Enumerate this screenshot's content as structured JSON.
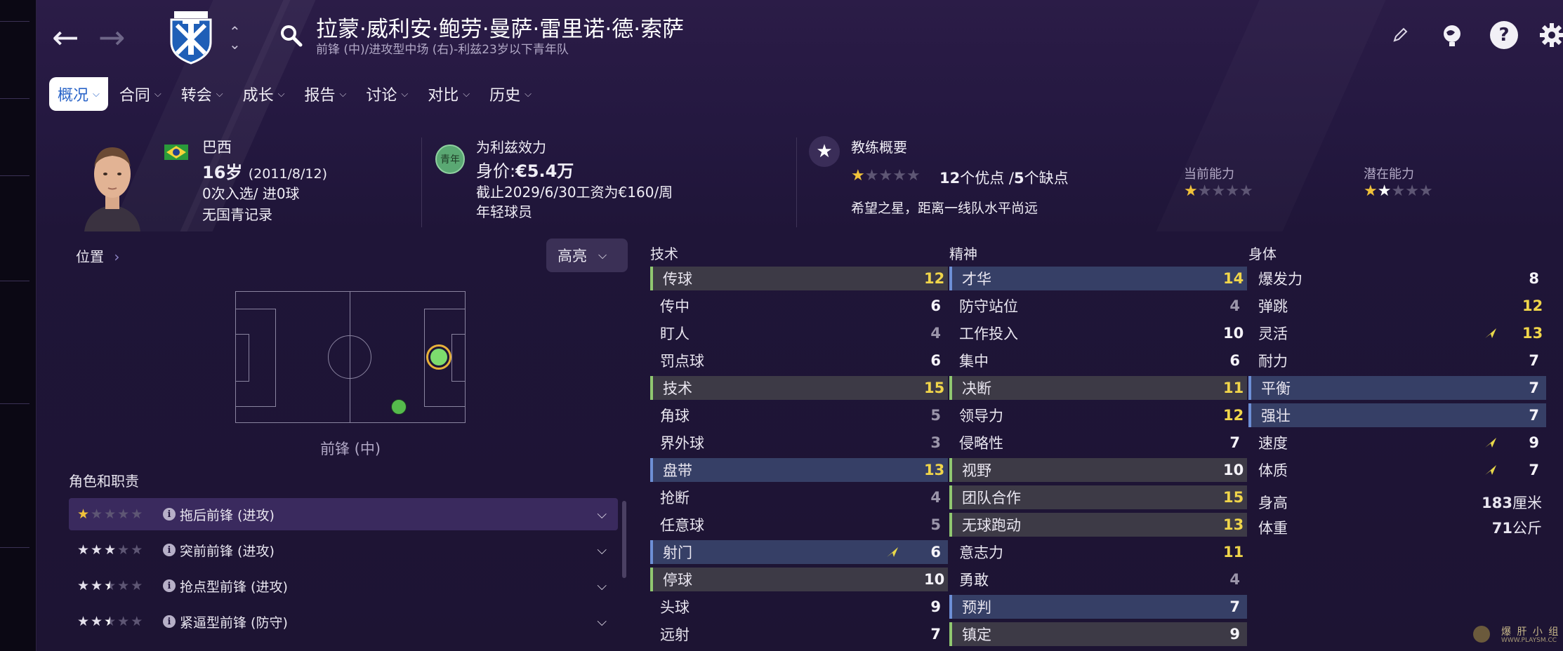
{
  "header": {
    "player_name": "拉蒙·威利安·鲍劳·曼萨·雷里诺·德·索萨",
    "subtitle": "前锋 (中)/进攻型中场 (右)-利兹23岁以下青年队"
  },
  "tabs": [
    {
      "label": "概况",
      "active": true
    },
    {
      "label": "合同",
      "active": false
    },
    {
      "label": "转会",
      "active": false
    },
    {
      "label": "成长",
      "active": false
    },
    {
      "label": "报告",
      "active": false
    },
    {
      "label": "讨论",
      "active": false
    },
    {
      "label": "对比",
      "active": false
    },
    {
      "label": "历史",
      "active": false
    }
  ],
  "profile": {
    "nationality": "巴西",
    "age": "16岁",
    "birth": "(2011/8/12)",
    "caps": "0次入选/ 进0球",
    "youth_record": "无国青记录"
  },
  "contract": {
    "badge": "青年",
    "club": "为利兹效力",
    "value_label": "身价:",
    "value": "€5.4万",
    "wage": "截止2029/6/30工资为€160/周",
    "type": "年轻球员"
  },
  "coach": {
    "title": "教练概要",
    "strengths_count": "12",
    "strengths_label": "个优点 /",
    "weaknesses_count": "5",
    "weaknesses_label": "个缺点",
    "summary": "希望之星，距离一线队水平尚远",
    "rating_stars": 1,
    "current_ability_label": "当前能力",
    "current_ability_stars": 1,
    "potential_ability_label": "潜在能力",
    "potential_ability_stars": 2
  },
  "position": {
    "label": "位置",
    "highlight_button": "高亮",
    "main_position": "前锋 (中)",
    "roles_title": "角色和职责"
  },
  "roles": [
    {
      "stars": 1,
      "name": "拖后前锋 (进攻)",
      "selected": true
    },
    {
      "stars": 3,
      "name": "突前前锋 (进攻)",
      "selected": false
    },
    {
      "stars": 2.5,
      "name": "抢点型前锋 (进攻)",
      "selected": false
    },
    {
      "stars": 2.5,
      "name": "紧逼型前锋 (防守)",
      "selected": false
    }
  ],
  "attributes": {
    "technical": {
      "title": "技术",
      "items": [
        {
          "name": "传球",
          "value": "12",
          "hl": "g",
          "color": "yellow"
        },
        {
          "name": "传中",
          "value": "6",
          "hl": "",
          "color": "white"
        },
        {
          "name": "盯人",
          "value": "4",
          "hl": "",
          "color": "grey"
        },
        {
          "name": "罚点球",
          "value": "6",
          "hl": "",
          "color": "white"
        },
        {
          "name": "技术",
          "value": "15",
          "hl": "g",
          "color": "yellow"
        },
        {
          "name": "角球",
          "value": "5",
          "hl": "",
          "color": "grey"
        },
        {
          "name": "界外球",
          "value": "3",
          "hl": "",
          "color": "grey"
        },
        {
          "name": "盘带",
          "value": "13",
          "hl": "b",
          "color": "yellow"
        },
        {
          "name": "抢断",
          "value": "4",
          "hl": "",
          "color": "grey"
        },
        {
          "name": "任意球",
          "value": "5",
          "hl": "",
          "color": "grey"
        },
        {
          "name": "射门",
          "value": "6",
          "hl": "b",
          "color": "white",
          "trend": true
        },
        {
          "name": "停球",
          "value": "10",
          "hl": "g",
          "color": "white"
        },
        {
          "name": "头球",
          "value": "9",
          "hl": "",
          "color": "white"
        },
        {
          "name": "远射",
          "value": "7",
          "hl": "",
          "color": "white"
        }
      ]
    },
    "mental": {
      "title": "精神",
      "items": [
        {
          "name": "才华",
          "value": "14",
          "hl": "b",
          "color": "yellow"
        },
        {
          "name": "防守站位",
          "value": "4",
          "hl": "",
          "color": "grey"
        },
        {
          "name": "工作投入",
          "value": "10",
          "hl": "",
          "color": "white"
        },
        {
          "name": "集中",
          "value": "6",
          "hl": "",
          "color": "white"
        },
        {
          "name": "决断",
          "value": "11",
          "hl": "g",
          "color": "yellow"
        },
        {
          "name": "领导力",
          "value": "12",
          "hl": "",
          "color": "yellow"
        },
        {
          "name": "侵略性",
          "value": "7",
          "hl": "",
          "color": "white"
        },
        {
          "name": "视野",
          "value": "10",
          "hl": "g",
          "color": "white"
        },
        {
          "name": "团队合作",
          "value": "15",
          "hl": "g",
          "color": "yellow"
        },
        {
          "name": "无球跑动",
          "value": "13",
          "hl": "g",
          "color": "yellow"
        },
        {
          "name": "意志力",
          "value": "11",
          "hl": "",
          "color": "yellow"
        },
        {
          "name": "勇敢",
          "value": "4",
          "hl": "",
          "color": "grey"
        },
        {
          "name": "预判",
          "value": "7",
          "hl": "b",
          "color": "white"
        },
        {
          "name": "镇定",
          "value": "9",
          "hl": "g",
          "color": "white"
        }
      ]
    },
    "physical": {
      "title": "身体",
      "items": [
        {
          "name": "爆发力",
          "value": "8",
          "hl": "",
          "color": "white"
        },
        {
          "name": "弹跳",
          "value": "12",
          "hl": "",
          "color": "yellow"
        },
        {
          "name": "灵活",
          "value": "13",
          "hl": "",
          "color": "yellow",
          "trend": true
        },
        {
          "name": "耐力",
          "value": "7",
          "hl": "",
          "color": "white"
        },
        {
          "name": "平衡",
          "value": "7",
          "hl": "b",
          "color": "white"
        },
        {
          "name": "强壮",
          "value": "7",
          "hl": "b",
          "color": "white"
        },
        {
          "name": "速度",
          "value": "9",
          "hl": "",
          "color": "white",
          "trend": true
        },
        {
          "name": "体质",
          "value": "7",
          "hl": "",
          "color": "white",
          "trend": true
        }
      ]
    }
  },
  "body": {
    "height_label": "身高",
    "height_value": "183",
    "height_unit": "厘米",
    "weight_label": "体重",
    "weight_value": "71",
    "weight_unit": "公斤"
  },
  "watermark": {
    "site": "WWW.PLAYSM.CC",
    "name": "爆 肝 小 组"
  },
  "colors": {
    "accent_yellow": "#f0d54a",
    "highlight_green": "#90c870",
    "highlight_blue": "#6d8fd6",
    "background": "#1d1433"
  },
  "icons": {
    "back": "arrow-left-icon",
    "forward": "arrow-right-icon",
    "club": "club-crest-icon",
    "search": "search-icon",
    "edit": "pencil-icon",
    "scout": "scout-globe-icon",
    "help": "help-icon",
    "settings": "gear-icon"
  }
}
